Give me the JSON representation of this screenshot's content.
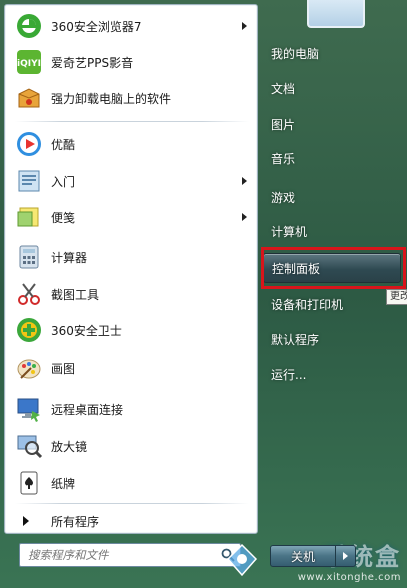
{
  "programs": [
    {
      "label": "360安全浏览器7",
      "icon": "360-browser-icon",
      "has_arrow": true
    },
    {
      "label": "爱奇艺PPS影音",
      "icon": "iqiyi-icon",
      "has_arrow": false
    },
    {
      "label": "强力卸载电脑上的软件",
      "icon": "uninstall-box-icon",
      "has_arrow": false
    },
    {
      "label": "优酷",
      "icon": "youku-icon",
      "has_arrow": false
    },
    {
      "label": "入门",
      "icon": "getting-started-icon",
      "has_arrow": true
    },
    {
      "label": "便笺",
      "icon": "sticky-notes-icon",
      "has_arrow": true
    },
    {
      "label": "计算器",
      "icon": "calculator-icon",
      "has_arrow": false
    },
    {
      "label": "截图工具",
      "icon": "snipping-tool-icon",
      "has_arrow": false
    },
    {
      "label": "360安全卫士",
      "icon": "360-safeguard-icon",
      "has_arrow": false
    },
    {
      "label": "画图",
      "icon": "paint-icon",
      "has_arrow": false
    },
    {
      "label": "远程桌面连接",
      "icon": "remote-desktop-icon",
      "has_arrow": false
    },
    {
      "label": "放大镜",
      "icon": "magnifier-icon",
      "has_arrow": false
    },
    {
      "label": "纸牌",
      "icon": "solitaire-icon",
      "has_arrow": false
    }
  ],
  "all_programs_label": "所有程序",
  "search": {
    "placeholder": "搜索程序和文件"
  },
  "right_items": [
    {
      "label": "我的电脑"
    },
    {
      "label": "文档"
    },
    {
      "label": "图片"
    },
    {
      "label": "音乐"
    },
    {
      "label": "游戏"
    },
    {
      "label": "计算机"
    },
    {
      "label": "控制面板",
      "highlight": true
    },
    {
      "label": "设备和打印机"
    },
    {
      "label": "默认程序"
    },
    {
      "label": "运行..."
    }
  ],
  "tooltip_text": "更改",
  "shutdown_label": "关机",
  "watermark": {
    "main": "系统盒",
    "sub": "www.xitonghe.com"
  },
  "colors": {
    "highlight_outline": "#d8151b",
    "menu_bg": "#2d5a44"
  }
}
